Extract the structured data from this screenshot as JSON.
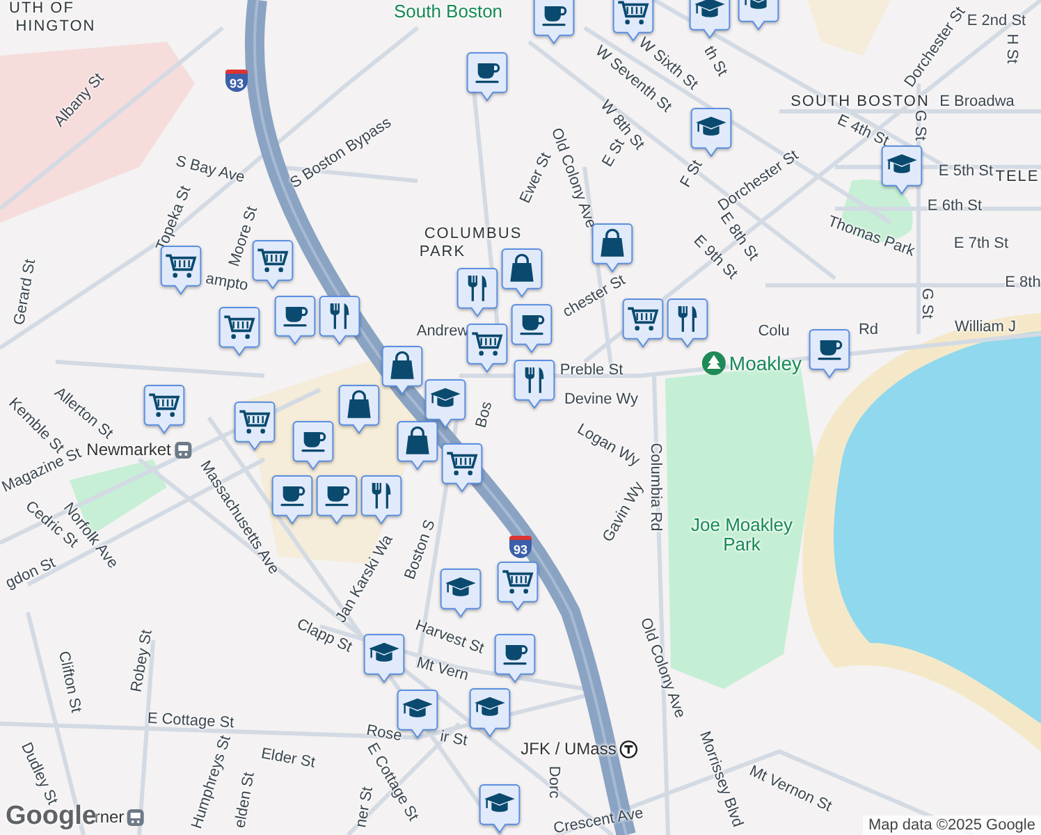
{
  "labels": [
    {
      "text": "UTH OF",
      "kind": "district"
    },
    {
      "text": "HINGTON",
      "kind": "district"
    },
    {
      "text": "South Boston",
      "kind": "park"
    },
    {
      "text": "Albany St",
      "kind": "street"
    },
    {
      "text": "S Boston Bypass",
      "kind": "street"
    },
    {
      "text": "S Bay Ave",
      "kind": "street"
    },
    {
      "text": "Topeka St",
      "kind": "street"
    },
    {
      "text": "Moore St",
      "kind": "street"
    },
    {
      "text": "Gerard St",
      "kind": "street"
    },
    {
      "text": "ampto",
      "kind": "street"
    },
    {
      "text": "Allerton St",
      "kind": "street"
    },
    {
      "text": "Kemble St",
      "kind": "street"
    },
    {
      "text": "Newmarket",
      "kind": "station"
    },
    {
      "text": "Magazine St",
      "kind": "street"
    },
    {
      "text": "Cedric St",
      "kind": "street"
    },
    {
      "text": "Norfolk Ave",
      "kind": "street"
    },
    {
      "text": "gdon St",
      "kind": "street"
    },
    {
      "text": "Massachusetts Ave",
      "kind": "street"
    },
    {
      "text": "Bos",
      "kind": "street"
    },
    {
      "text": "Jan Karski Wa",
      "kind": "street"
    },
    {
      "text": "Boston S",
      "kind": "street"
    },
    {
      "text": "Clapp St",
      "kind": "street"
    },
    {
      "text": "Harvest St",
      "kind": "street"
    },
    {
      "text": "Mt Vern",
      "kind": "street"
    },
    {
      "text": "Clifton St",
      "kind": "street"
    },
    {
      "text": "Robey St",
      "kind": "street"
    },
    {
      "text": "E Cottage St",
      "kind": "street"
    },
    {
      "text": "Elder St",
      "kind": "street"
    },
    {
      "text": "Humphreys St",
      "kind": "street"
    },
    {
      "text": "Dudley St",
      "kind": "street"
    },
    {
      "text": "elden St",
      "kind": "street"
    },
    {
      "text": "Rose",
      "kind": "street"
    },
    {
      "text": "ir St",
      "kind": "street"
    },
    {
      "text": "E Cottage St",
      "kind": "street"
    },
    {
      "text": "ner St",
      "kind": "street"
    },
    {
      "text": "Dorc",
      "kind": "street"
    },
    {
      "text": "rner",
      "kind": "station"
    },
    {
      "text": "COLUMBUS",
      "kind": "district"
    },
    {
      "text": "PARK",
      "kind": "district"
    },
    {
      "text": "Andrew",
      "kind": "street"
    },
    {
      "text": "Preble St",
      "kind": "street"
    },
    {
      "text": "Devine Wy",
      "kind": "street"
    },
    {
      "text": "Logan Wy",
      "kind": "street"
    },
    {
      "text": "Gavin Wy",
      "kind": "street"
    },
    {
      "text": "Old Colony Ave",
      "kind": "street"
    },
    {
      "text": "Ewer St",
      "kind": "street"
    },
    {
      "text": "W 8th St",
      "kind": "street"
    },
    {
      "text": "E St",
      "kind": "street"
    },
    {
      "text": "F St",
      "kind": "street"
    },
    {
      "text": "W Seventh St",
      "kind": "street"
    },
    {
      "text": "W Sixth St",
      "kind": "street"
    },
    {
      "text": "th St",
      "kind": "street"
    },
    {
      "text": "Dorchester St",
      "kind": "street"
    },
    {
      "text": "Dorchester St",
      "kind": "street"
    },
    {
      "text": "chester St",
      "kind": "street"
    },
    {
      "text": "E 8th St",
      "kind": "street"
    },
    {
      "text": "E 9th St",
      "kind": "street"
    },
    {
      "text": "E 2nd St",
      "kind": "street"
    },
    {
      "text": "H St",
      "kind": "street"
    },
    {
      "text": "SOUTH BOSTON",
      "kind": "district"
    },
    {
      "text": "E Broadwa",
      "kind": "street"
    },
    {
      "text": "E 4th St",
      "kind": "street"
    },
    {
      "text": "G St",
      "kind": "street"
    },
    {
      "text": "E 5th St",
      "kind": "street"
    },
    {
      "text": "TELE",
      "kind": "district"
    },
    {
      "text": "E 6th St",
      "kind": "street"
    },
    {
      "text": "E 7th St",
      "kind": "street"
    },
    {
      "text": "Thomas Park",
      "kind": "street"
    },
    {
      "text": "E 8th",
      "kind": "street"
    },
    {
      "text": "G St",
      "kind": "street"
    },
    {
      "text": "Colu",
      "kind": "street"
    },
    {
      "text": "Rd",
      "kind": "street"
    },
    {
      "text": "William J",
      "kind": "street"
    },
    {
      "text": "Moakley",
      "kind": "poi"
    },
    {
      "text": "Joe Moakley Park",
      "kind": "park"
    },
    {
      "text": "Columbia Rd",
      "kind": "street"
    },
    {
      "text": "Old Colony Ave",
      "kind": "street"
    },
    {
      "text": "Morrissey Blvd",
      "kind": "street"
    },
    {
      "text": "Mt Vernon St",
      "kind": "street"
    },
    {
      "text": "JFK / UMass",
      "kind": "subway"
    },
    {
      "text": "Crescent Ave",
      "kind": "street"
    }
  ],
  "shields": [
    {
      "text": "93"
    },
    {
      "text": "93"
    }
  ],
  "pins": [
    {
      "kind": "cafe"
    },
    {
      "kind": "cafe"
    },
    {
      "kind": "grocery"
    },
    {
      "kind": "school"
    },
    {
      "kind": "school"
    },
    {
      "kind": "school"
    },
    {
      "kind": "school"
    },
    {
      "kind": "shop"
    },
    {
      "kind": "grocery"
    },
    {
      "kind": "restaurant"
    },
    {
      "kind": "cafe"
    },
    {
      "kind": "grocery"
    },
    {
      "kind": "grocery"
    },
    {
      "kind": "grocery"
    },
    {
      "kind": "cafe"
    },
    {
      "kind": "restaurant"
    },
    {
      "kind": "shop"
    },
    {
      "kind": "shop"
    },
    {
      "kind": "school"
    },
    {
      "kind": "restaurant"
    },
    {
      "kind": "grocery"
    },
    {
      "kind": "shop"
    },
    {
      "kind": "cafe"
    },
    {
      "kind": "restaurant"
    },
    {
      "kind": "grocery"
    },
    {
      "kind": "grocery"
    },
    {
      "kind": "cafe"
    },
    {
      "kind": "restaurant"
    },
    {
      "kind": "cafe"
    },
    {
      "kind": "cafe"
    },
    {
      "kind": "shop"
    },
    {
      "kind": "grocery"
    },
    {
      "kind": "school"
    },
    {
      "kind": "grocery"
    },
    {
      "kind": "school"
    },
    {
      "kind": "cafe"
    },
    {
      "kind": "school"
    },
    {
      "kind": "school"
    },
    {
      "kind": "school"
    }
  ],
  "logo": "Google",
  "attribution": "Map data ©2025 Google"
}
